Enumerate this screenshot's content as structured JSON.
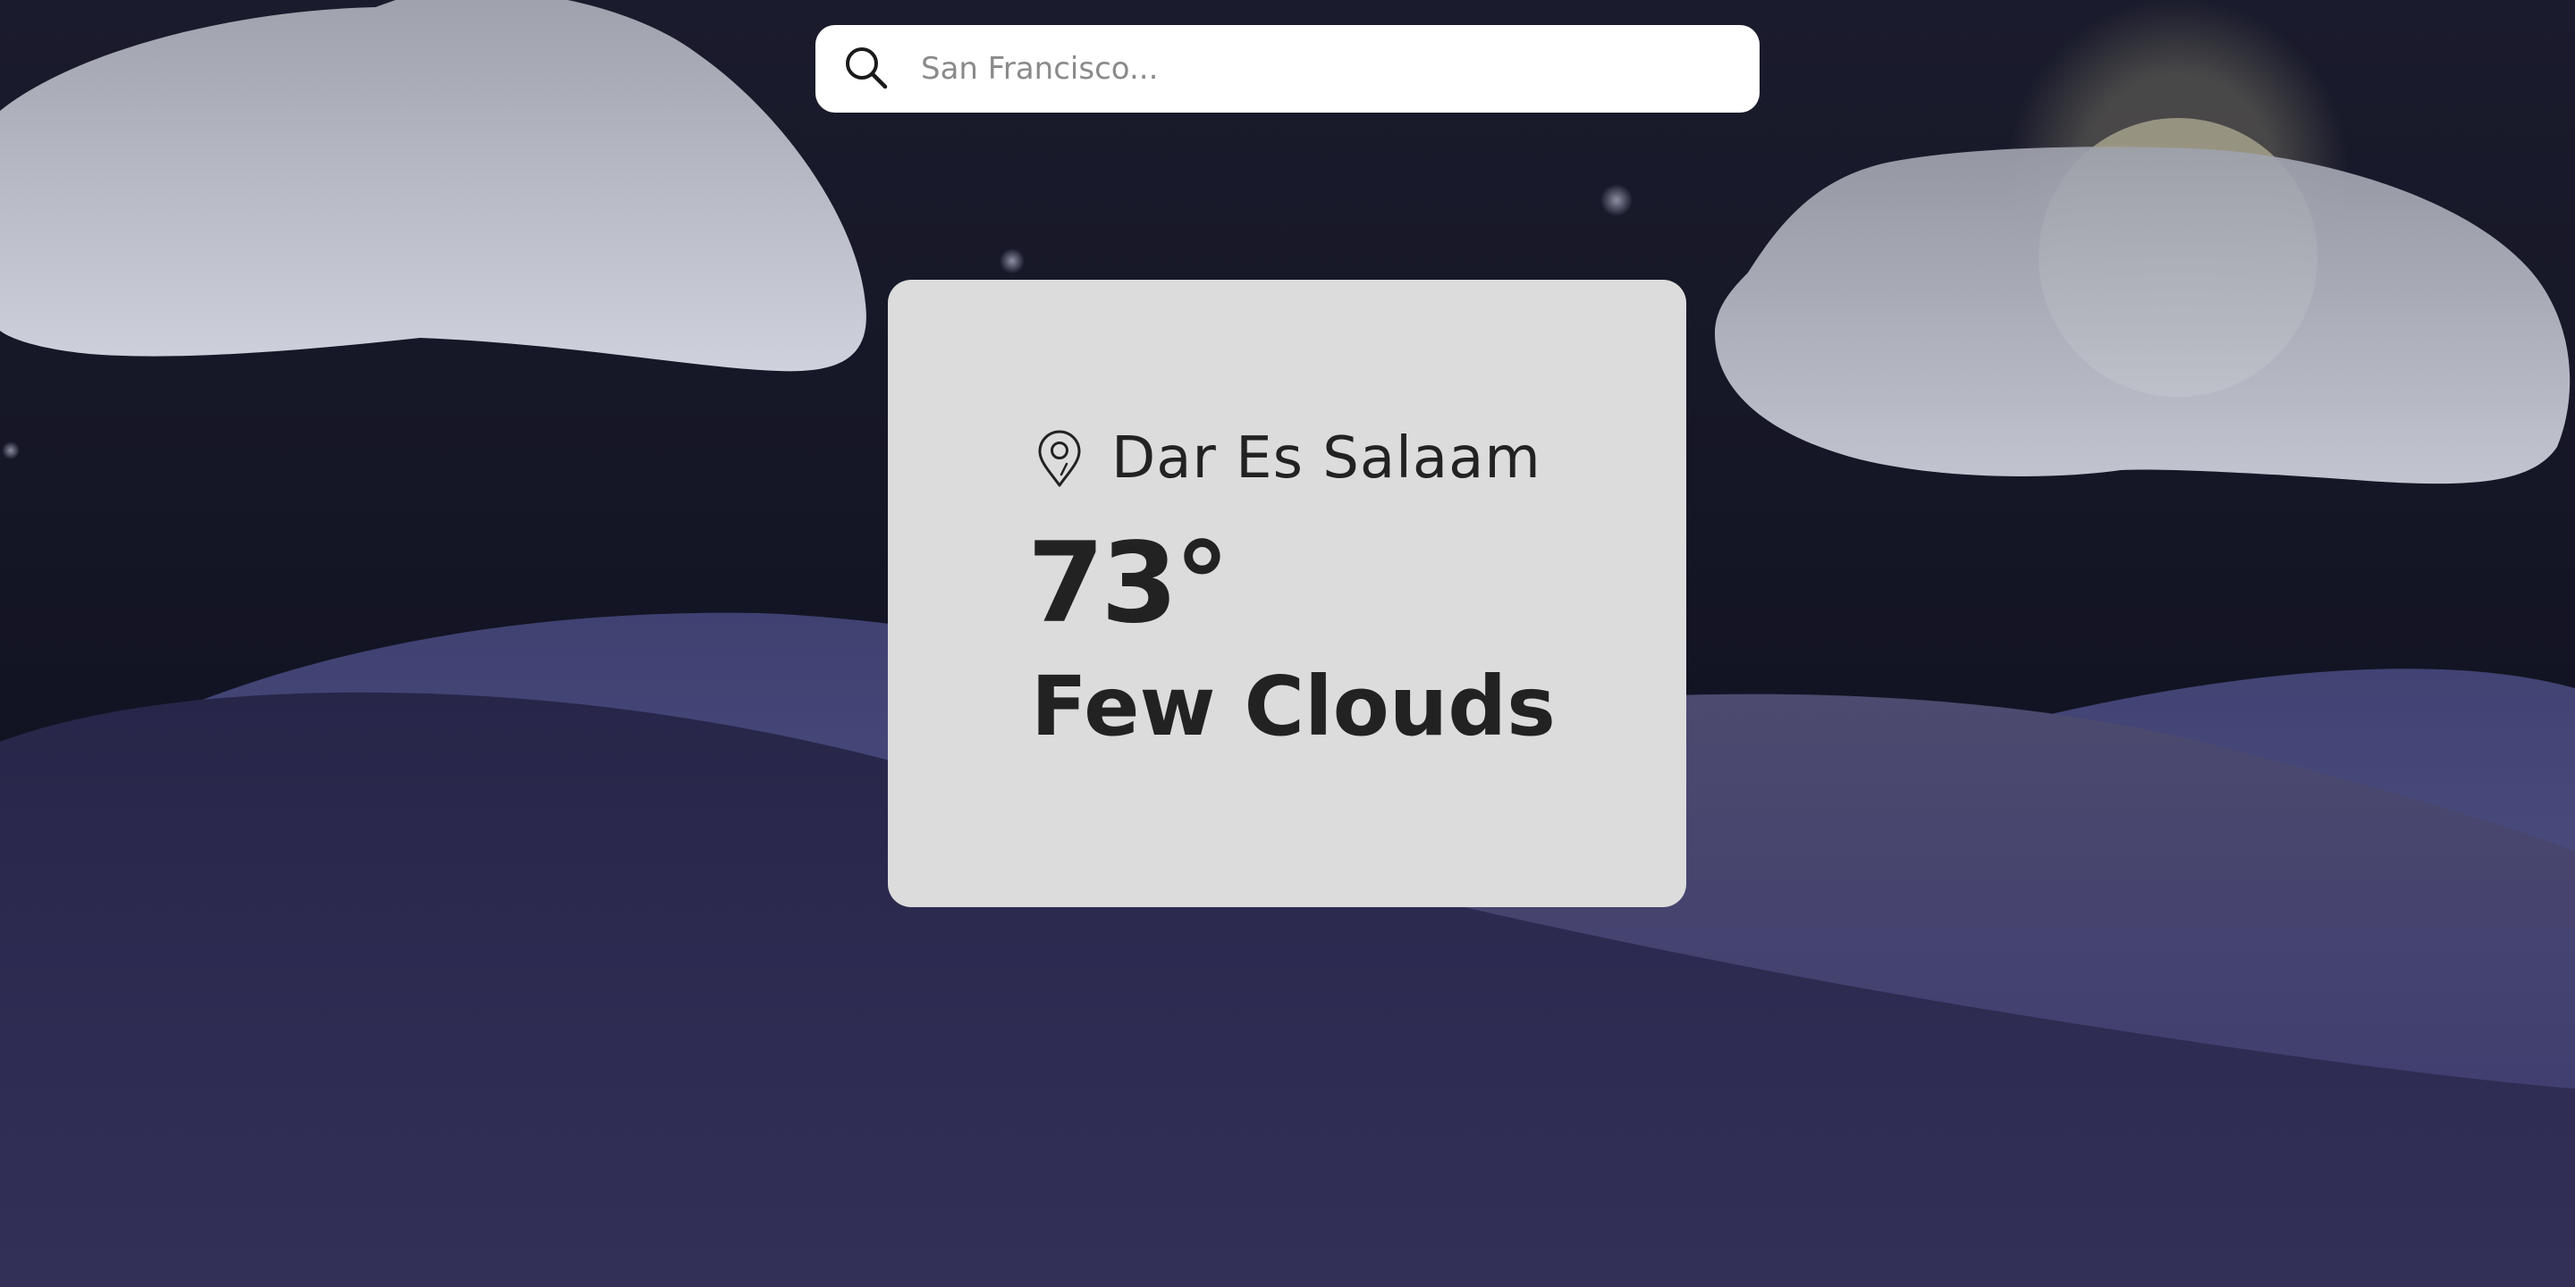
{
  "search": {
    "placeholder": "San Francisco...",
    "value": ""
  },
  "weather": {
    "location": "Dar Es Salaam",
    "temperature": "73°",
    "condition": "Few Clouds"
  },
  "icons": {
    "search": "search-icon",
    "location": "map-pin-icon"
  },
  "colors": {
    "sky": "#171828",
    "card": "#dcdcdc",
    "text": "#222222",
    "cloud": "#c4c8d2",
    "hill_back": "#4a4d7e",
    "hill_front": "#2b2a52"
  }
}
